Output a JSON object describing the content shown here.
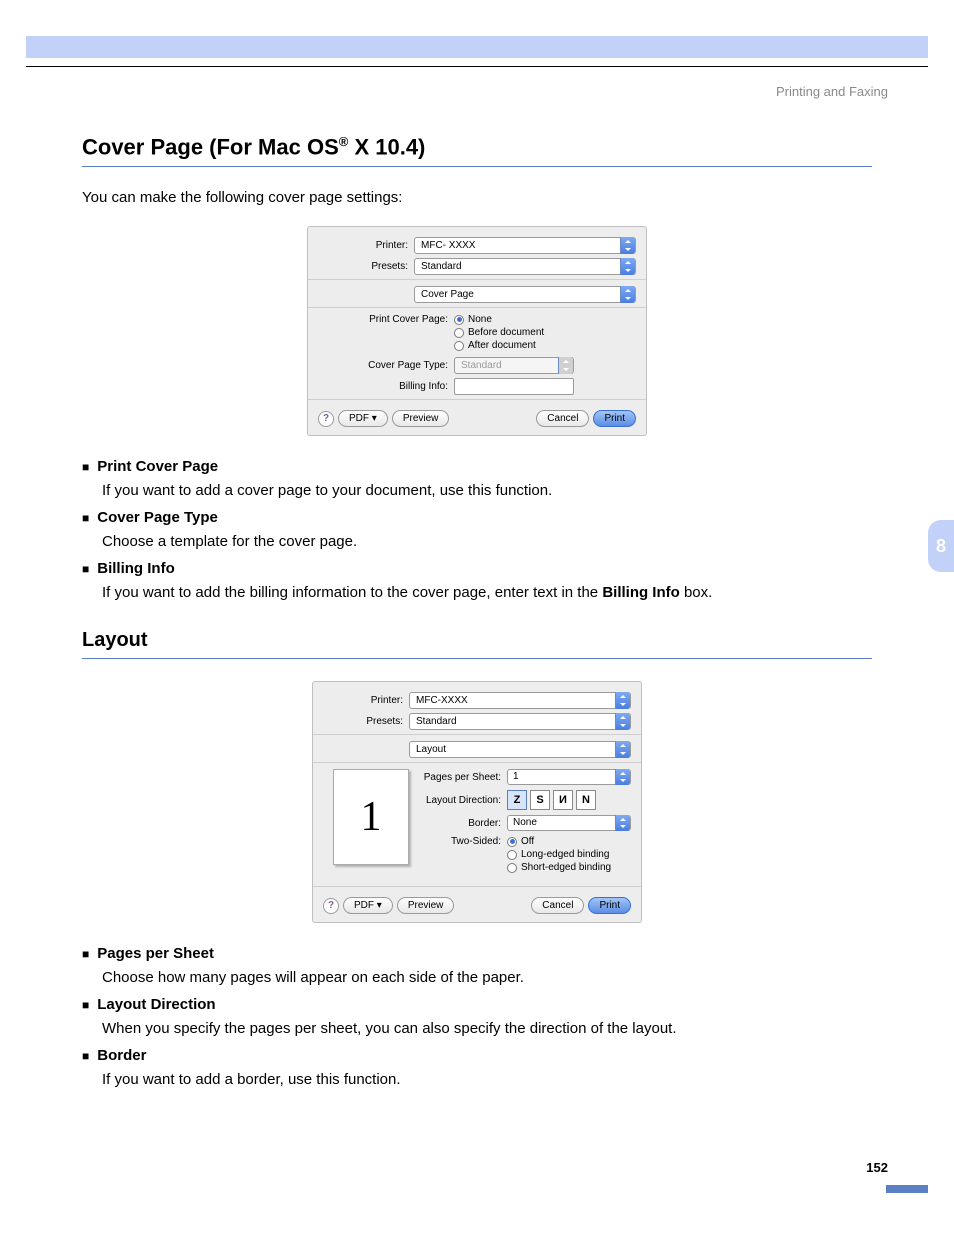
{
  "header": {
    "section": "Printing and Faxing"
  },
  "chapter_tab": "8",
  "page_number": "152",
  "section1": {
    "title_pre": "Cover Page (For Mac OS",
    "title_sup": "®",
    "title_post": " X 10.4)",
    "intro": "You can make the following cover page settings:",
    "dialog": {
      "printer_label": "Printer:",
      "printer_value": "MFC- XXXX",
      "presets_label": "Presets:",
      "presets_value": "Standard",
      "pane_value": "Cover Page",
      "pcp_label": "Print Cover Page:",
      "pcp_opts": [
        "None",
        "Before document",
        "After document"
      ],
      "cpt_label": "Cover Page Type:",
      "cpt_value": "Standard",
      "billing_label": "Billing Info:",
      "help": "?",
      "pdf": "PDF ▾",
      "preview": "Preview",
      "cancel": "Cancel",
      "print": "Print"
    },
    "items": [
      {
        "title": "Print Cover Page",
        "desc": "If you want to add a cover page to your document, use this function."
      },
      {
        "title": "Cover Page Type",
        "desc": "Choose a template for the cover page."
      },
      {
        "title": "Billing Info",
        "desc_pre": "If you want to add the billing information to the cover page, enter text in the ",
        "desc_bold": "Billing Info",
        "desc_post": " box."
      }
    ]
  },
  "section2": {
    "title": "Layout",
    "dialog": {
      "printer_label": "Printer:",
      "printer_value": "MFC-XXXX",
      "presets_label": "Presets:",
      "presets_value": "Standard",
      "pane_value": "Layout",
      "preview_number": "1",
      "pps_label": "Pages per Sheet:",
      "pps_value": "1",
      "ld_label": "Layout Direction:",
      "ld_opts": [
        "Z",
        "S",
        "И",
        "N"
      ],
      "border_label": "Border:",
      "border_value": "None",
      "ts_label": "Two-Sided:",
      "ts_opts": [
        "Off",
        "Long-edged binding",
        "Short-edged binding"
      ],
      "help": "?",
      "pdf": "PDF ▾",
      "preview": "Preview",
      "cancel": "Cancel",
      "print": "Print"
    },
    "items": [
      {
        "title": "Pages per Sheet",
        "desc": "Choose how many pages will appear on each side of the paper."
      },
      {
        "title": "Layout Direction",
        "desc": "When you specify the pages per sheet, you can also specify the direction of the layout."
      },
      {
        "title": "Border",
        "desc": "If you want to add a border, use this function."
      }
    ]
  }
}
